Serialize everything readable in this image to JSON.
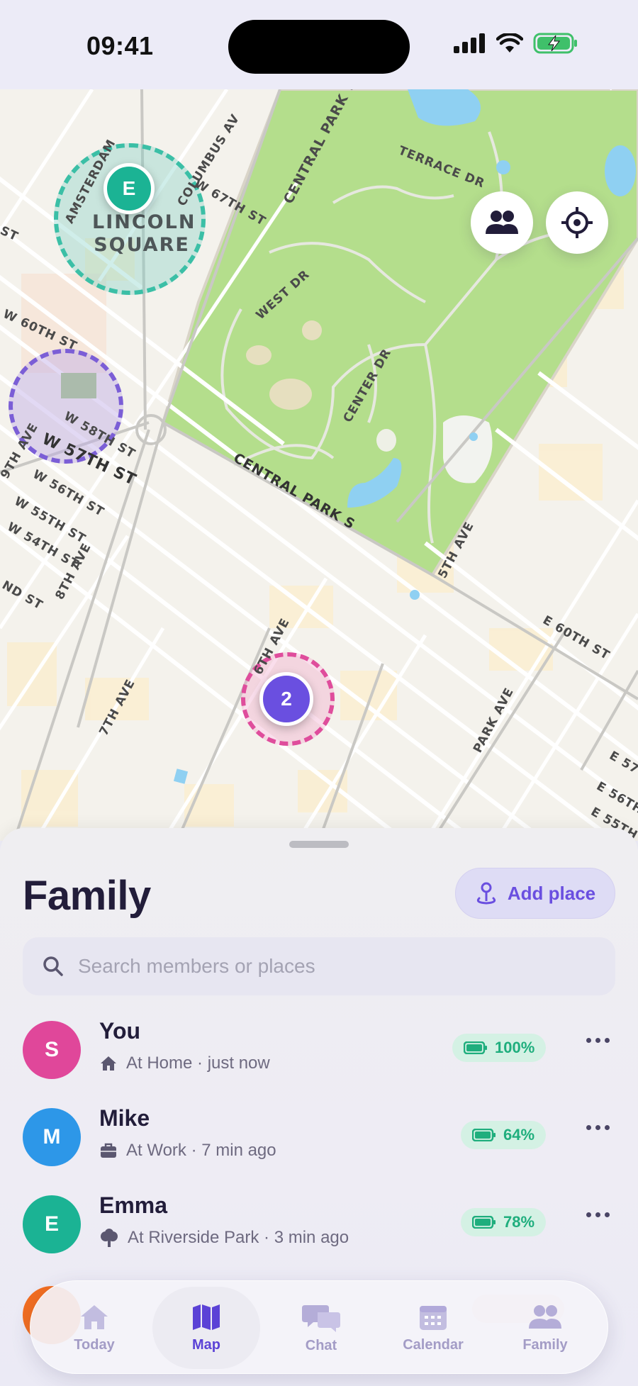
{
  "status_bar": {
    "time": "09:41"
  },
  "map": {
    "street_labels": {
      "amsterdam": "AMSTERDAM",
      "columbus": "COLUMBUS AV",
      "w67": "W 67TH ST",
      "cpw": "CENTRAL PARK W",
      "terrace": "TERRACE DR",
      "west_dr": "WEST DR",
      "center_dr": "CENTER DR",
      "w60": "W 60TH ST",
      "w58": "W 58TH ST",
      "ninth": "9TH AVE",
      "w57": "W 57TH ST",
      "w56": "W 56TH ST",
      "w55": "W 55TH ST",
      "w54": "W 54TH ST",
      "eighth": "8TH AVE",
      "cps": "CENTRAL PARK S",
      "fifth": "5TH AVE",
      "e60": "E 60TH ST",
      "sixth": "6TH AVE",
      "seventh": "7TH AVE",
      "park": "PARK AVE",
      "e57": "E 57",
      "e56": "E 56TH",
      "e55": "E 55TH",
      "st": "ST",
      "nd": "ND ST"
    },
    "neighborhood_line1": "LINCOLN",
    "neighborhood_line2": "SQUARE",
    "pin_emma": "E",
    "cluster_count": "2",
    "colors": {
      "park": "#b4de8c",
      "water": "#8fd0f2",
      "road": "#ffffff"
    }
  },
  "sheet": {
    "title": "Family",
    "add_place_label": "Add place",
    "search_placeholder": "Search members or places",
    "members": [
      {
        "initial": "S",
        "name": "You",
        "status": "At Home · just now",
        "battery": "100%",
        "color": "#e0479a",
        "icon": "home-icon"
      },
      {
        "initial": "M",
        "name": "Mike",
        "status": "At Work · 7 min ago",
        "battery": "64%",
        "color": "#2d97e8",
        "icon": "briefcase-icon"
      },
      {
        "initial": "E",
        "name": "Emma",
        "status": "At Riverside Park · 3 min ago",
        "battery": "78%",
        "color": "#1bb394",
        "icon": "tree-icon"
      }
    ]
  },
  "tabs": [
    {
      "label": "Today",
      "icon": "house-icon"
    },
    {
      "label": "Map",
      "icon": "map-icon",
      "active": true
    },
    {
      "label": "Chat",
      "icon": "chat-icon"
    },
    {
      "label": "Calendar",
      "icon": "calendar-icon"
    },
    {
      "label": "Family",
      "icon": "people-icon"
    }
  ]
}
